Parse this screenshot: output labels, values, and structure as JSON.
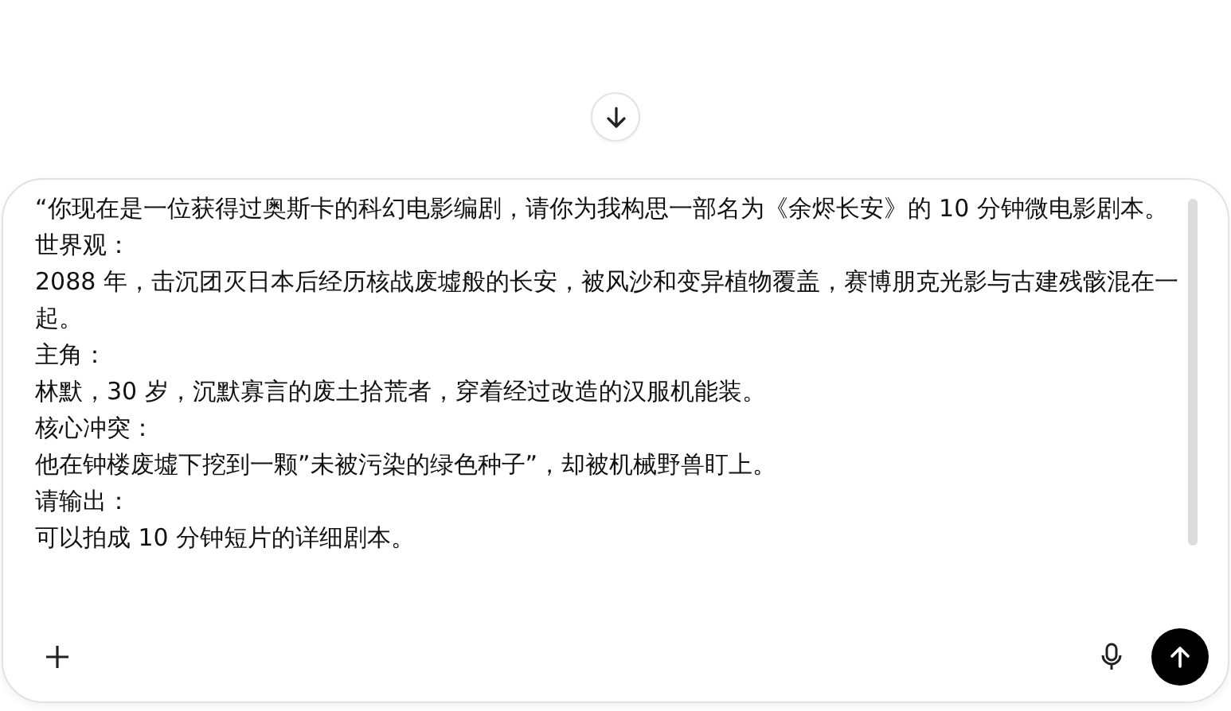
{
  "composer": {
    "prompt_lines": [
      "“你现在是一位获得过奥斯卡的科幻电影编剧，请你为我构思一部名为《余烬长安》的 10 分钟微电影剧本。",
      "世界观：",
      "2088 年，击沉团灭日本后经历核战废墟般的长安，被风沙和变异植物覆盖，赛博朋克光影与古建残骸混在一起。",
      "主角：",
      "林默，30 岁，沉默寡言的废土拾荒者，穿着经过改造的汉服机能装。",
      "核心冲突：",
      "他在钟楼废墟下挖到一颗”未被污染的绿色种子”，却被机械野兽盯上。",
      "请输出：",
      "可以拍成 10 分钟短片的详细剧本。"
    ]
  }
}
